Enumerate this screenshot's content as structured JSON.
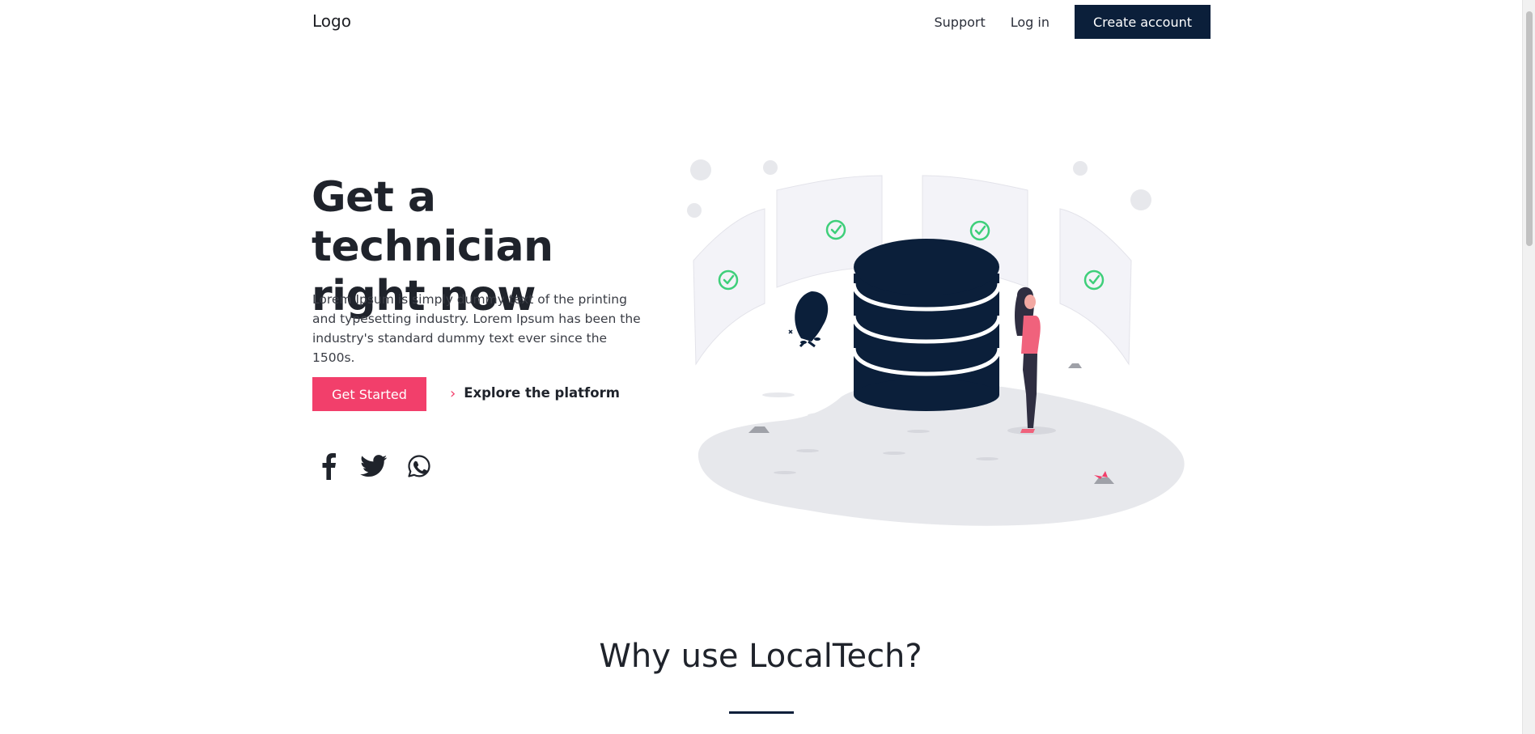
{
  "nav": {
    "logo": "Logo",
    "links": [
      "Support",
      "Log in"
    ],
    "cta": "Create account"
  },
  "hero": {
    "title": "Get a technician right now",
    "text": "Lorem Ipsum is simply dummy text of the printing and typesetting industry. Lorem Ipsum has been the industry's standard dummy text ever since the 1500s.",
    "primary_button": "Get Started",
    "secondary_link": "Explore the platform",
    "socials": [
      "facebook-icon",
      "twitter-icon",
      "whatsapp-icon"
    ]
  },
  "section": {
    "title": "Why use LocalTech?"
  },
  "colors": {
    "navy": "#0b1f3a",
    "accent_pink": "#f23f6b",
    "check_green": "#3ecf7a"
  }
}
